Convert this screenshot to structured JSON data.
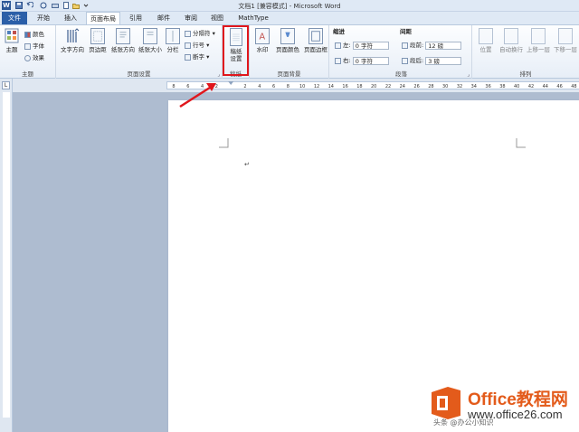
{
  "window": {
    "title": "文档1 [兼容模式] - Microsoft Word",
    "app_icon": "W"
  },
  "tabs": [
    {
      "label": "文件"
    },
    {
      "label": "开始"
    },
    {
      "label": "插入"
    },
    {
      "label": "页面布局"
    },
    {
      "label": "引用"
    },
    {
      "label": "邮件"
    },
    {
      "label": "审阅"
    },
    {
      "label": "视图"
    },
    {
      "label": "MathType"
    }
  ],
  "ribbon": {
    "theme": {
      "themes_label": "主题",
      "colors_label": "颜色",
      "fonts_label": "字体",
      "effects_label": "效果",
      "group_label": "主题"
    },
    "page_setup": {
      "text_direction_label": "文字方向",
      "margins_label": "页边距",
      "orientation_label": "纸张方向",
      "size_label": "纸张大小",
      "columns_label": "分栏",
      "breaks_label": "分隔符",
      "line_numbers_label": "行号",
      "hyphenation_label": "断字",
      "group_label": "页面设置"
    },
    "manuscript": {
      "button_line1": "稿纸",
      "button_line2": "设置",
      "group_label": "稿纸"
    },
    "page_background": {
      "watermark_label": "水印",
      "page_color_label": "页面颜色",
      "page_borders_label": "页面边框",
      "group_label": "页面背景"
    },
    "paragraph": {
      "indent_title": "缩进",
      "spacing_title": "间距",
      "left_label": "左:",
      "left_value": "0 字符",
      "right_label": "右:",
      "right_value": "0 字符",
      "before_label": "段前:",
      "before_value": "12 磅",
      "after_label": "段后:",
      "after_value": "3 磅",
      "group_label": "段落"
    },
    "arrange": {
      "position_label": "位置",
      "wrap_label": "自动换行",
      "forward_label": "上移一层",
      "backward_label": "下移一层",
      "group_label": "排列"
    }
  },
  "ruler": {
    "ticks": [
      "8",
      "6",
      "4",
      "2",
      "",
      "2",
      "4",
      "6",
      "8",
      "10",
      "12",
      "14",
      "16",
      "18",
      "20",
      "22",
      "24",
      "26",
      "28",
      "30",
      "32",
      "34",
      "36",
      "38",
      "40",
      "42",
      "44",
      "46",
      "48"
    ]
  },
  "document": {
    "paragraph_mark": "↵"
  },
  "watermark": {
    "title": "Office教程网",
    "url": "www.office26.com",
    "handle": "头条 @办公小知识"
  },
  "colors": {
    "file_tab": "#2b5fa8",
    "highlight": "#e0161c",
    "watermark_orange": "#e35b1b",
    "workspace": "#aebcd0"
  }
}
